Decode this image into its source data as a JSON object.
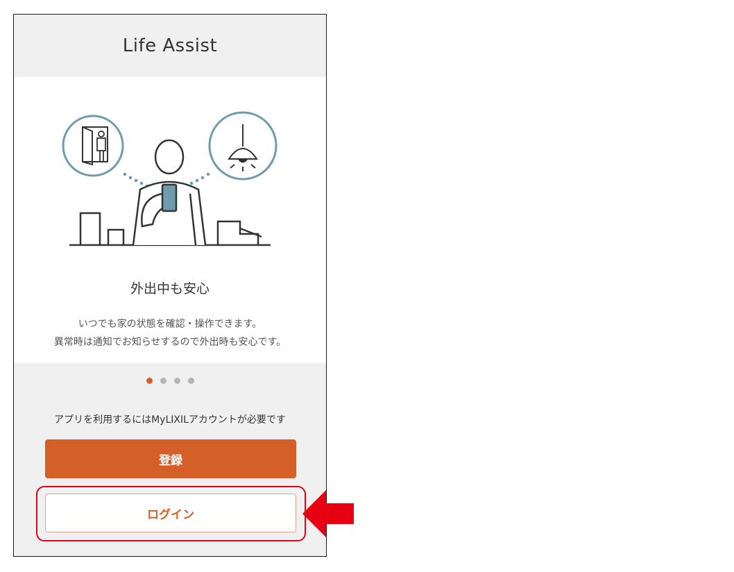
{
  "app": {
    "title": "Life Assist"
  },
  "slide": {
    "title": "外出中も安心",
    "description_line1": "いつでも家の状態を確認・操作できます。",
    "description_line2": "異常時は通知でお知らせするので外出時も安心です。"
  },
  "pager": {
    "total": 4,
    "active_index": 0,
    "active_color": "#d55f28",
    "inactive_color": "#b4b4b4"
  },
  "account": {
    "note": "アプリを利用するにはMyLIXILアカウントが必要です"
  },
  "buttons": {
    "register_label": "登録",
    "login_label": "ログイン"
  },
  "colors": {
    "accent": "#d55f28",
    "highlight": "#e60012",
    "icon_circle": "#6e9cad",
    "phone_blue": "#6e9cad"
  },
  "icons": [
    "door-person-icon",
    "person-with-phone-icon",
    "ceiling-lamp-icon",
    "pointer-arrow-icon"
  ]
}
